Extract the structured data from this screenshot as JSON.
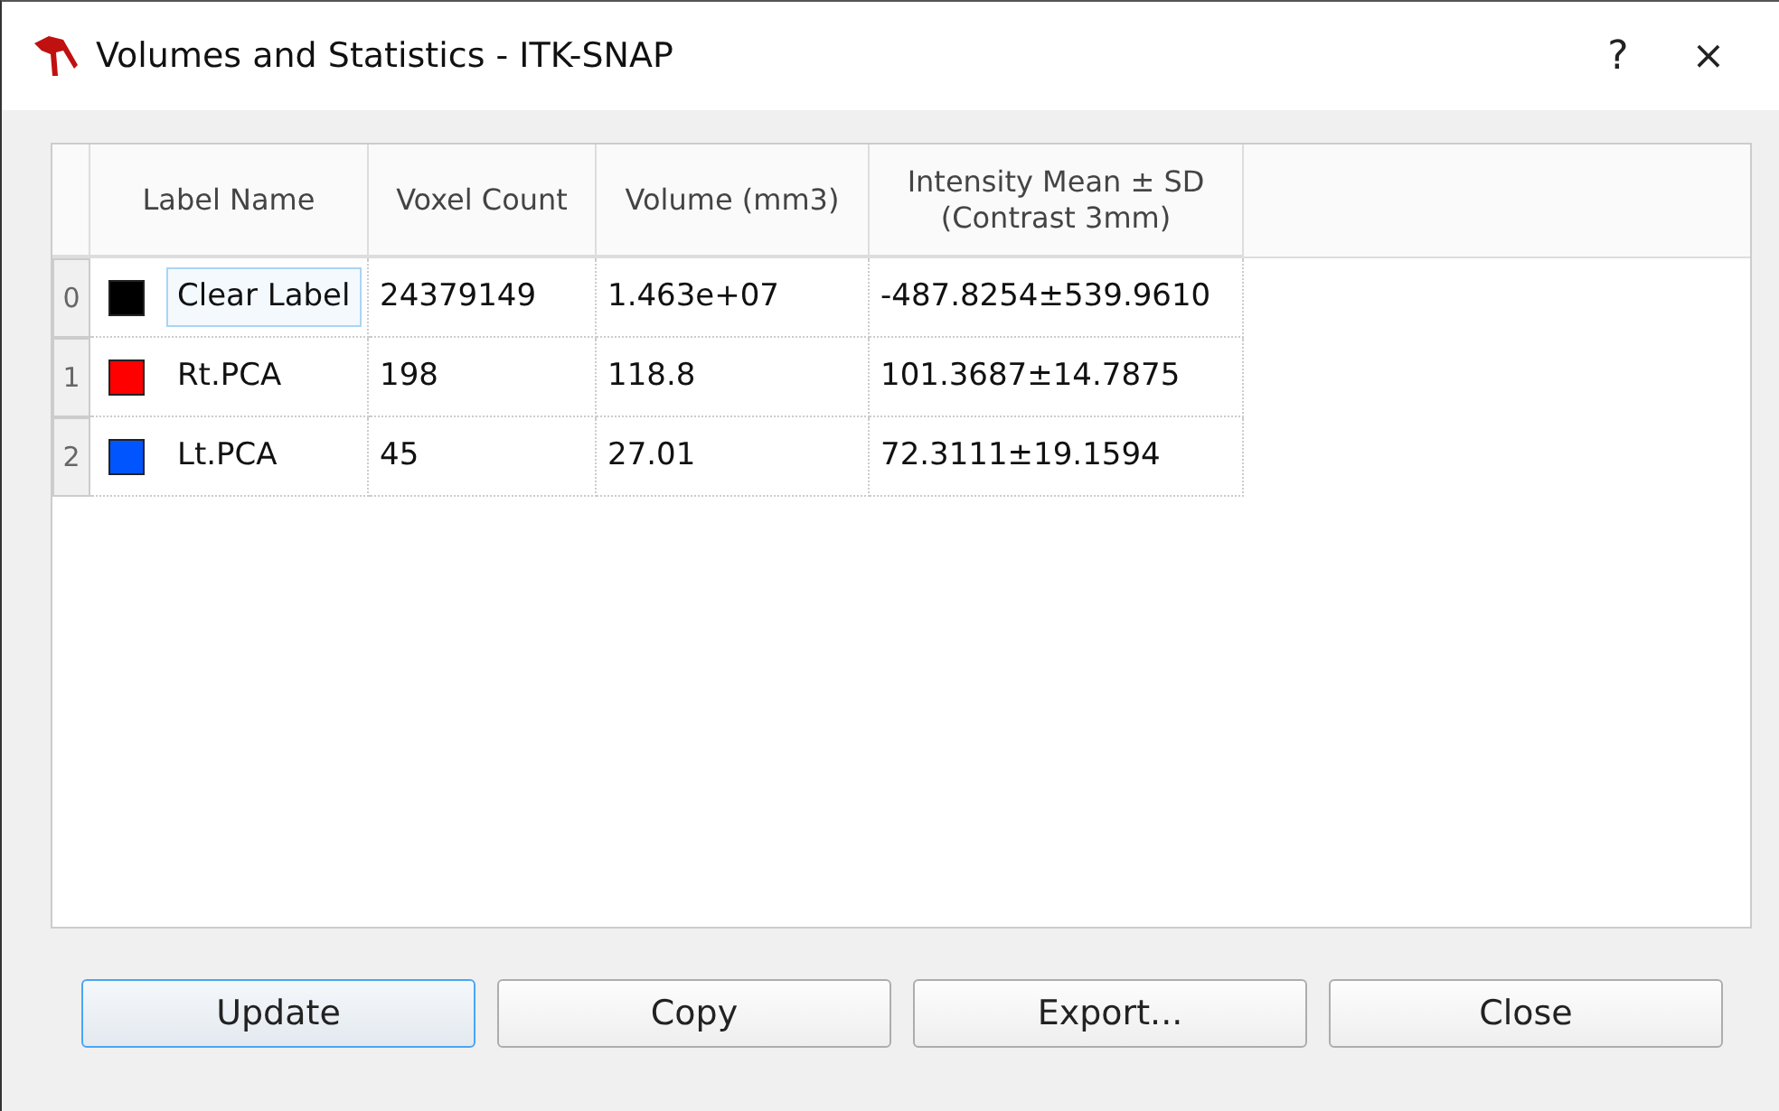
{
  "window": {
    "title": "Volumes and Statistics - ITK-SNAP",
    "help": "?",
    "close": "×"
  },
  "table": {
    "columns": [
      "Label Name",
      "Voxel Count",
      "Volume (mm3)",
      "Intensity Mean ± SD\n(Contrast 3mm)"
    ],
    "rows": [
      {
        "index": "0",
        "color": "#000000",
        "name": "Clear Label",
        "voxels": "24379149",
        "volume": "1.463e+07",
        "intensity": "-487.8254±539.9610",
        "focused": true
      },
      {
        "index": "1",
        "color": "#ff0000",
        "name": "Rt.PCA",
        "voxels": "198",
        "volume": "118.8",
        "intensity": "101.3687±14.7875",
        "focused": false
      },
      {
        "index": "2",
        "color": "#0055ff",
        "name": "Lt.PCA",
        "voxels": "45",
        "volume": "27.01",
        "intensity": "72.3111±19.1594",
        "focused": false
      }
    ]
  },
  "buttons": [
    {
      "label": "Update",
      "default": true
    },
    {
      "label": "Copy",
      "default": false
    },
    {
      "label": "Export...",
      "default": false
    },
    {
      "label": "Close",
      "default": false
    }
  ]
}
